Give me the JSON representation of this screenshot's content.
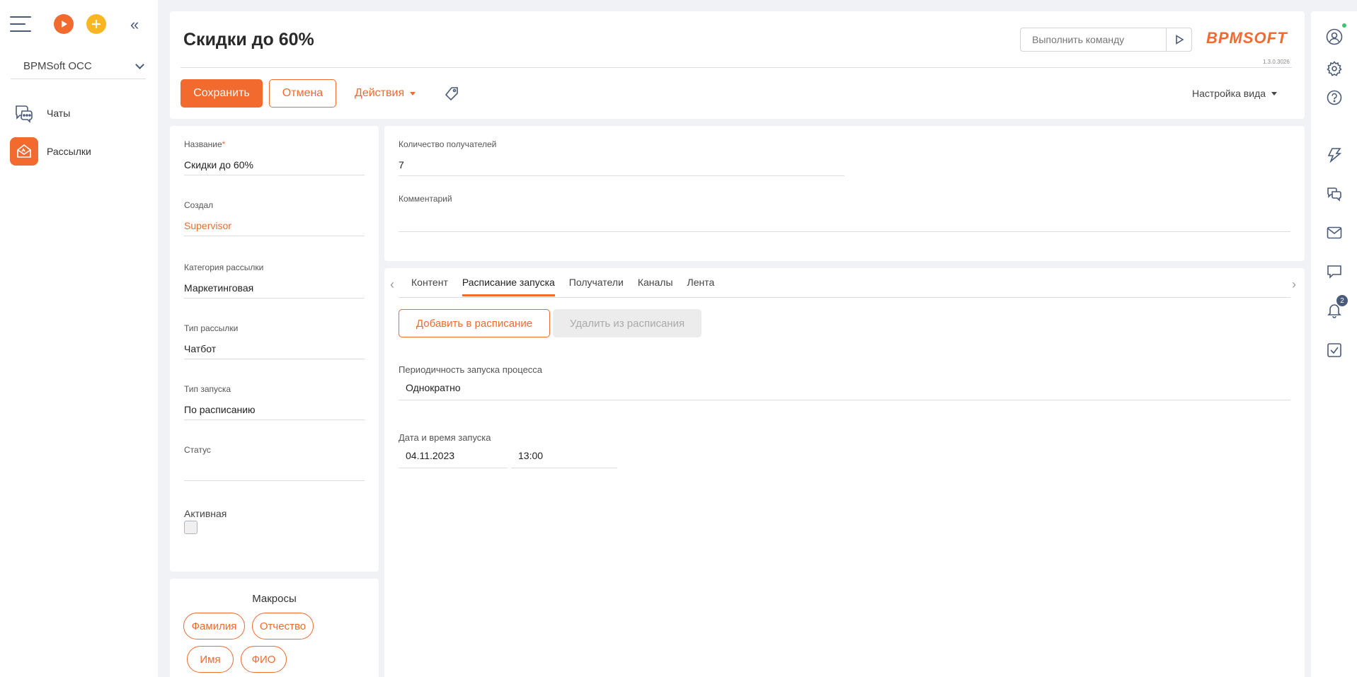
{
  "sidebar": {
    "workspace": "BPMSoft OCC",
    "items": [
      {
        "label": "Чаты",
        "icon": "chats-icon"
      },
      {
        "label": "Рассылки",
        "icon": "mailing-icon"
      }
    ]
  },
  "header": {
    "title": "Скидки до 60%",
    "command_placeholder": "Выполнить команду",
    "logo": "BPMSOFT",
    "version": "1.3.0.3026",
    "save_label": "Сохранить",
    "cancel_label": "Отмена",
    "actions_label": "Действия",
    "view_setup_label": "Настройка вида"
  },
  "fields": {
    "name_label": "Название",
    "name_required": "*",
    "name_value": "Скидки до 60%",
    "creator_label": "Создал",
    "creator_value": "Supervisor",
    "category_label": "Категория рассылки",
    "category_value": "Маркетинговая",
    "type_label": "Тип рассылки",
    "type_value": "Чатбот",
    "launch_type_label": "Тип запуска",
    "launch_type_value": "По расписанию",
    "status_label": "Статус",
    "status_value": "",
    "active_label": "Активная",
    "active_checked": false
  },
  "macros": {
    "title": "Макросы",
    "chips": [
      "Фамилия",
      "Отчество",
      "Имя",
      "ФИО"
    ]
  },
  "info": {
    "recipients_label": "Количество получателей",
    "recipients_value": "7",
    "comment_label": "Комментарий",
    "comment_value": ""
  },
  "tabs": {
    "items": [
      "Контент",
      "Расписание запуска",
      "Получатели",
      "Каналы",
      "Лента"
    ],
    "active_index": 1
  },
  "schedule": {
    "add_label": "Добавить в расписание",
    "remove_label": "Удалить из расписания",
    "periodicity_label": "Периодичность запуска процесса",
    "periodicity_value": "Однократно",
    "datetime_label": "Дата и время запуска",
    "date_value": "04.11.2023",
    "time_value": "13:00"
  },
  "rightbar": {
    "notifications_count": "2"
  },
  "colors": {
    "accent": "#f26a2e",
    "accent_yellow": "#f8b623",
    "icon": "#4a5a7a"
  }
}
